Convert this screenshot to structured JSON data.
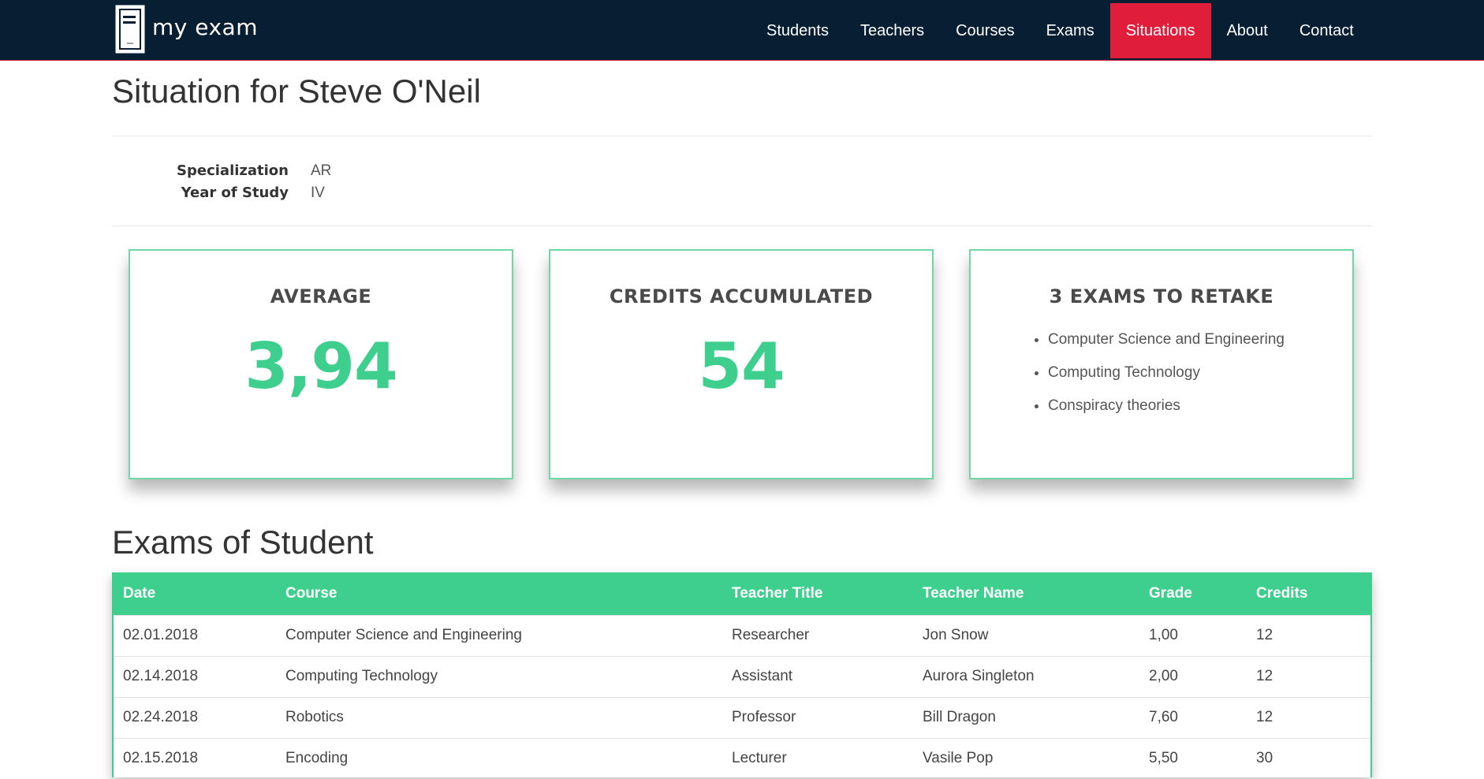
{
  "brand": {
    "name": "my exam"
  },
  "nav": {
    "items": [
      {
        "label": "Students"
      },
      {
        "label": "Teachers"
      },
      {
        "label": "Courses"
      },
      {
        "label": "Exams"
      },
      {
        "label": "Situations",
        "active": true
      },
      {
        "label": "About"
      },
      {
        "label": "Contact"
      }
    ]
  },
  "page": {
    "title": "Situation for Steve O'Neil"
  },
  "info": {
    "specialization_label": "Specialization",
    "specialization_value": "AR",
    "year_label": "Year of Study",
    "year_value": "IV"
  },
  "cards": {
    "average": {
      "title": "AVERAGE",
      "value": "3,94"
    },
    "credits": {
      "title": "CREDITS ACCUMULATED",
      "value": "54"
    },
    "retake": {
      "title": "3 EXAMS TO RETAKE",
      "items": [
        "Computer Science and Engineering",
        "Computing Technology",
        "Conspiracy theories"
      ]
    }
  },
  "exams": {
    "title": "Exams of Student",
    "columns": [
      "Date",
      "Course",
      "Teacher Title",
      "Teacher Name",
      "Grade",
      "Credits"
    ],
    "rows": [
      [
        "02.01.2018",
        "Computer Science and Engineering",
        "Researcher",
        "Jon Snow",
        "1,00",
        "12"
      ],
      [
        "02.14.2018",
        "Computing Technology",
        "Assistant",
        "Aurora Singleton",
        "2,00",
        "12"
      ],
      [
        "02.24.2018",
        "Robotics",
        "Professor",
        "Bill Dragon",
        "7,60",
        "12"
      ],
      [
        "02.15.2018",
        "Encoding",
        "Lecturer",
        "Vasile Pop",
        "5,50",
        "30"
      ]
    ]
  },
  "colors": {
    "navbar": "#071e33",
    "active": "#e11d3c",
    "accent": "#3ecf8e"
  }
}
